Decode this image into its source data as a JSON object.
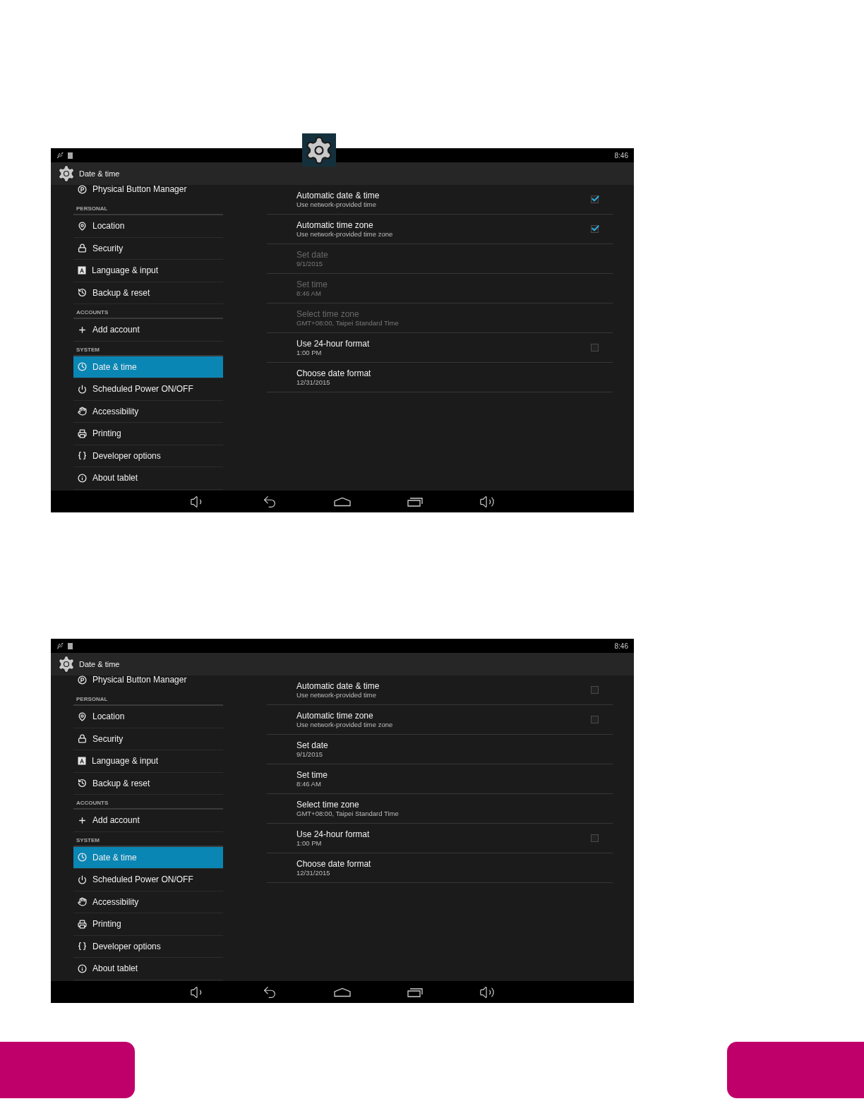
{
  "screenshots": [
    {
      "floating_settings_icon": true,
      "status_bar": {
        "time": "8:46"
      },
      "action_bar": {
        "title": "Date & time"
      },
      "sidebar": [
        {
          "kind": "item",
          "label": "Physical Button Manager",
          "selected": false
        },
        {
          "kind": "header",
          "label": "PERSONAL"
        },
        {
          "kind": "item",
          "label": "Location",
          "selected": false
        },
        {
          "kind": "item",
          "label": "Security",
          "selected": false
        },
        {
          "kind": "item",
          "label": "Language & input",
          "selected": false
        },
        {
          "kind": "item",
          "label": "Backup & reset",
          "selected": false
        },
        {
          "kind": "header",
          "label": "ACCOUNTS"
        },
        {
          "kind": "item",
          "label": "Add account",
          "selected": false
        },
        {
          "kind": "header",
          "label": "SYSTEM"
        },
        {
          "kind": "item",
          "label": "Date & time",
          "selected": true
        },
        {
          "kind": "item",
          "label": "Scheduled Power ON/OFF",
          "selected": false
        },
        {
          "kind": "item",
          "label": "Accessibility",
          "selected": false
        },
        {
          "kind": "item",
          "label": "Printing",
          "selected": false
        },
        {
          "kind": "item",
          "label": "Developer options",
          "selected": false
        },
        {
          "kind": "item",
          "label": "About tablet",
          "selected": false
        }
      ],
      "settings": [
        {
          "kind": "checkbox",
          "title": "Automatic date & time",
          "summary": "Use network-provided time",
          "disabled": false,
          "checked": true
        },
        {
          "kind": "checkbox",
          "title": "Automatic time zone",
          "summary": "Use network-provided time zone",
          "disabled": false,
          "checked": true
        },
        {
          "kind": "plain",
          "title": "Set date",
          "summary": "9/1/2015",
          "disabled": true
        },
        {
          "kind": "plain",
          "title": "Set time",
          "summary": "8:46 AM",
          "disabled": true
        },
        {
          "kind": "plain",
          "title": "Select time zone",
          "summary": "GMT+08:00, Taipei Standard Time",
          "disabled": true
        },
        {
          "kind": "checkbox",
          "title": "Use 24-hour format",
          "summary": "1:00 PM",
          "disabled": false,
          "checked": false
        },
        {
          "kind": "plain",
          "title": "Choose date format",
          "summary": "12/31/2015",
          "disabled": false
        }
      ]
    },
    {
      "floating_settings_icon": false,
      "status_bar": {
        "time": "8:46"
      },
      "action_bar": {
        "title": "Date & time"
      },
      "sidebar": [
        {
          "kind": "item",
          "label": "Physical Button Manager",
          "selected": false
        },
        {
          "kind": "header",
          "label": "PERSONAL"
        },
        {
          "kind": "item",
          "label": "Location",
          "selected": false
        },
        {
          "kind": "item",
          "label": "Security",
          "selected": false
        },
        {
          "kind": "item",
          "label": "Language & input",
          "selected": false
        },
        {
          "kind": "item",
          "label": "Backup & reset",
          "selected": false
        },
        {
          "kind": "header",
          "label": "ACCOUNTS"
        },
        {
          "kind": "item",
          "label": "Add account",
          "selected": false
        },
        {
          "kind": "header",
          "label": "SYSTEM"
        },
        {
          "kind": "item",
          "label": "Date & time",
          "selected": true
        },
        {
          "kind": "item",
          "label": "Scheduled Power ON/OFF",
          "selected": false
        },
        {
          "kind": "item",
          "label": "Accessibility",
          "selected": false
        },
        {
          "kind": "item",
          "label": "Printing",
          "selected": false
        },
        {
          "kind": "item",
          "label": "Developer options",
          "selected": false
        },
        {
          "kind": "item",
          "label": "About tablet",
          "selected": false
        }
      ],
      "settings": [
        {
          "kind": "checkbox",
          "title": "Automatic date & time",
          "summary": "Use network-provided time",
          "disabled": false,
          "checked": false
        },
        {
          "kind": "checkbox",
          "title": "Automatic time zone",
          "summary": "Use network-provided time zone",
          "disabled": false,
          "checked": false
        },
        {
          "kind": "plain",
          "title": "Set date",
          "summary": "9/1/2015",
          "disabled": false
        },
        {
          "kind": "plain",
          "title": "Set time",
          "summary": "8:46 AM",
          "disabled": false
        },
        {
          "kind": "plain",
          "title": "Select time zone",
          "summary": "GMT+08:00, Taipei Standard Time",
          "disabled": false
        },
        {
          "kind": "checkbox",
          "title": "Use 24-hour format",
          "summary": "1:00 PM",
          "disabled": false,
          "checked": false
        },
        {
          "kind": "plain",
          "title": "Choose date format",
          "summary": "12/31/2015",
          "disabled": false
        }
      ]
    }
  ]
}
